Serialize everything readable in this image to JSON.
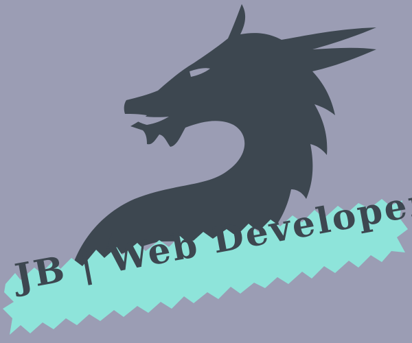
{
  "logo": {
    "text": "JB | Web Developer",
    "colors": {
      "background": "#9b9db4",
      "dragon": "#3d4750",
      "banner": "#8ee4da",
      "text": "#3d4750"
    },
    "icon": "dragon-icon"
  }
}
